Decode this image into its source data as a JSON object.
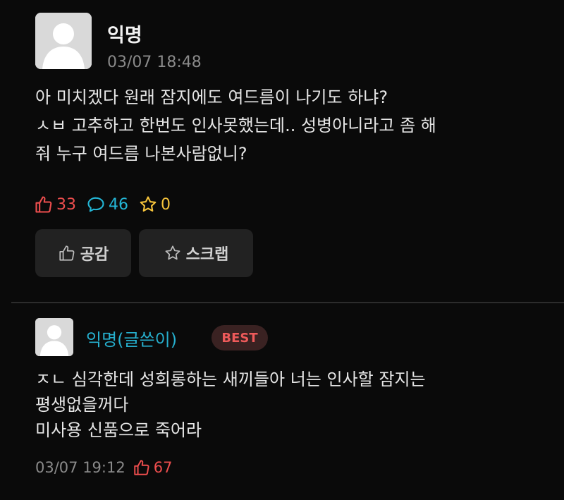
{
  "post": {
    "author": "익명",
    "date": "03/07 18:48",
    "lines": [
      "아 미치겠다 원래 잠지에도 여드름이 나기도 하냐?",
      "ㅅㅂ 고추하고 한번도 인사못했는데.. 성병아니라고 좀 해",
      "줘 누구 여드름 나본사람없니?"
    ],
    "stats": {
      "likes": "33",
      "comments": "46",
      "scraps": "0"
    },
    "buttons": {
      "like_label": "공감",
      "scrap_label": "스크랩"
    }
  },
  "comment": {
    "author": "익명(글쓴이)",
    "badge": "BEST",
    "lines": [
      "ㅈㄴ 심각한데 성희롱하는 새끼들아 너는 인사할 잠지는",
      "평생없을꺼다",
      "미사용 신품으로 죽어라"
    ],
    "date": "03/07 19:12",
    "likes": "67"
  },
  "colors": {
    "background": "#0a0a0a",
    "like": "#ee4e4e",
    "comment": "#23b6d6",
    "scrap": "#f5c33b",
    "author_accent": "#26b0cf"
  },
  "icons": {
    "avatar": "default-person-icon",
    "like": "thumbs-up-icon",
    "comment": "speech-bubble-icon",
    "scrap": "star-icon"
  }
}
